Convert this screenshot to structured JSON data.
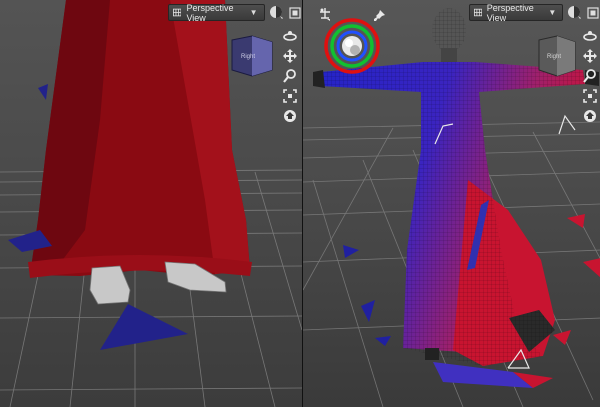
{
  "viewports": {
    "left": {
      "camera_label": "Perspective View"
    },
    "right": {
      "camera_label": "Perspective View"
    }
  },
  "icons": {
    "nav": [
      "rotate-orbit-icon",
      "move-pan-icon",
      "zoom-icon",
      "frame-icon",
      "home-icon"
    ],
    "header": [
      "shading-sphere-icon",
      "maximize-icon",
      "light-icon",
      "pin-icon"
    ]
  },
  "colors": {
    "viewport_bg": "#4b4b4b",
    "grid_line": "#8a8a8a",
    "dress_left": "#8a0a12",
    "mesh_blue": "#2020d0",
    "mesh_red": "#cc1030",
    "gizmo_red": "#e01010",
    "gizmo_green": "#10c030",
    "gizmo_blue": "#2050ff"
  }
}
